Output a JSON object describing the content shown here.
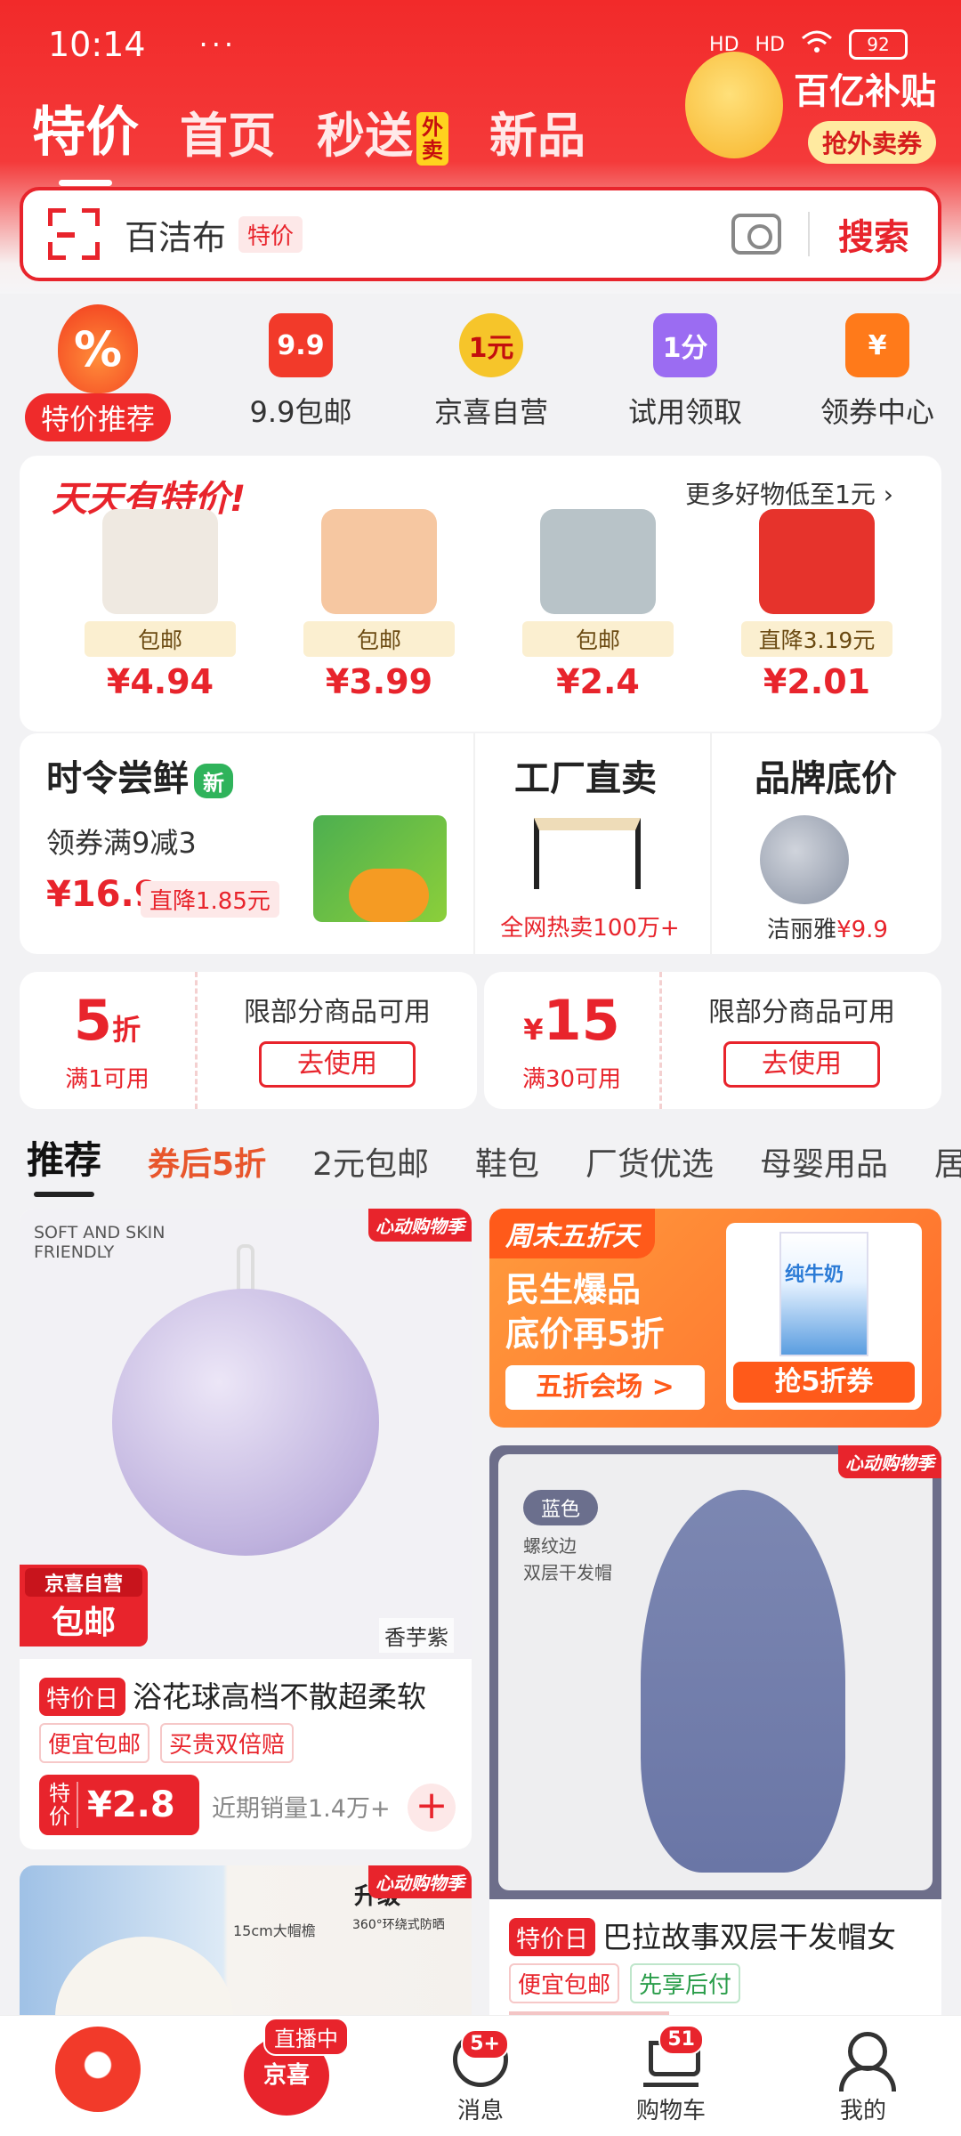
{
  "status": {
    "time": "10:14",
    "dots": "···",
    "signal1": "HD",
    "signal2": "HD",
    "battery": "92"
  },
  "tabs": [
    {
      "label": "特价",
      "active": true
    },
    {
      "label": "首页"
    },
    {
      "label": "秒送",
      "badge": "外卖"
    },
    {
      "label": "新品"
    }
  ],
  "promo": {
    "title": "百亿补贴",
    "button": "抢外卖券"
  },
  "search": {
    "keyword": "百洁布",
    "tag": "特价",
    "button": "搜索"
  },
  "quick": [
    {
      "label": "特价推荐",
      "icon": "percent-flame-icon",
      "glyph": "%"
    },
    {
      "label": "9.9包邮",
      "icon": "nine-nine-icon",
      "glyph": "9.9",
      "color": "#f23a2a"
    },
    {
      "label": "京喜自营",
      "icon": "one-yuan-icon",
      "glyph": "1元",
      "color": "#f6c52a"
    },
    {
      "label": "试用领取",
      "icon": "one-fen-bag-icon",
      "glyph": "1分",
      "color": "#9b6cf2"
    },
    {
      "label": "领券中心",
      "icon": "coupon-icon",
      "glyph": "¥",
      "color": "#ff7a1a"
    }
  ],
  "daily": {
    "title": "天天有特价!",
    "more": "更多好物低至1元",
    "items": [
      {
        "tag": "包邮",
        "price": "¥4.94",
        "color": "#efe9e1"
      },
      {
        "tag": "包邮",
        "price": "¥3.99",
        "color": "#f6c7a1"
      },
      {
        "tag": "包邮",
        "price": "¥2.4",
        "color": "#b8c3c8"
      },
      {
        "tag": "直降3.19元",
        "price": "¥2.01",
        "color": "#e6332c"
      }
    ]
  },
  "fresh": {
    "title": "时令尝鲜",
    "new": "新",
    "sub": "领券满9减3",
    "price": "¥16.9",
    "drop": "直降1.85元"
  },
  "factory": {
    "title": "工厂直卖",
    "sub": "全网热卖100万+"
  },
  "brand": {
    "title": "品牌底价",
    "name": "洁丽雅",
    "price": "¥9.9"
  },
  "coupons": [
    {
      "value": "5",
      "unit": "折",
      "cond": "满1可用",
      "desc": "限部分商品可用",
      "button": "去使用"
    },
    {
      "value": "15",
      "unit": "¥",
      "cond": "满30可用",
      "desc": "限部分商品可用",
      "button": "去使用"
    }
  ],
  "categories": [
    "推荐",
    "券后5折",
    "2元包邮",
    "鞋包",
    "厂货优选",
    "母婴用品",
    "居"
  ],
  "feed1": {
    "soft": "SOFT AND SKIN FRIENDLY",
    "corner": "心动购物季",
    "jx1": "京喜自营",
    "jx2": "包邮",
    "color": "香芋紫",
    "day": "特价日",
    "title": "浴花球高档不散超柔软",
    "tags": [
      "便宜包邮",
      "买贵双倍赔"
    ],
    "te": "特价",
    "price": "¥2.8",
    "sales": "近期销量1.4万+",
    "plus": "+"
  },
  "weekend": {
    "title": "周末五折天",
    "line1": "民生爆品",
    "line2": "底价再5折",
    "button": "五折会场 >",
    "milk": "纯牛奶",
    "button2": "抢5折券"
  },
  "feed2": {
    "corner": "心动购物季",
    "color": "蓝色",
    "desc1": "螺纹边",
    "desc2": "双层干发帽",
    "day": "特价日",
    "title": "巴拉故事双层干发帽女",
    "tags": [
      "便宜包邮",
      "先享后付"
    ]
  },
  "feed3": {
    "corner": "心动购物季",
    "up": "升级",
    "upsub": "360°环绕式防晒",
    "cm": "15cm大帽檐"
  },
  "bottom": [
    {
      "label": "",
      "icon": "jd-mascot-home-icon"
    },
    {
      "label": "直播中",
      "icon": "jingxi-icon",
      "glyph": "京喜"
    },
    {
      "label": "消息",
      "icon": "message-icon",
      "badge": "5+"
    },
    {
      "label": "购物车",
      "icon": "cart-icon",
      "badge": "51"
    },
    {
      "label": "我的",
      "icon": "profile-icon"
    }
  ]
}
